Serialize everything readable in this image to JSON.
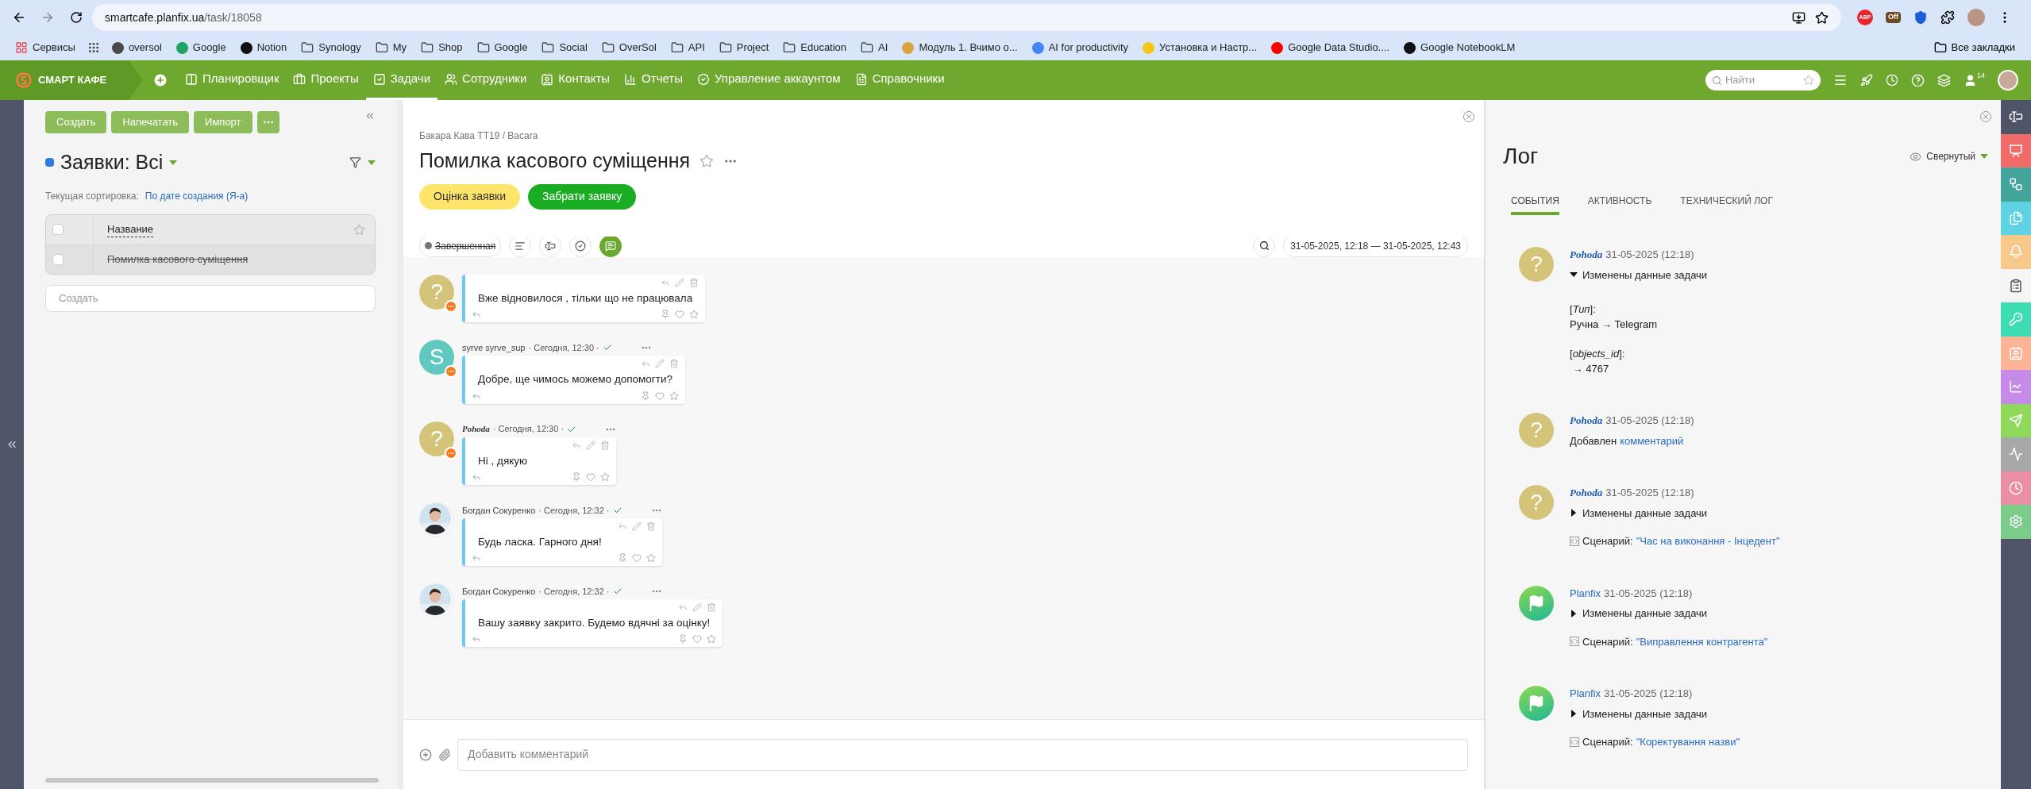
{
  "browser": {
    "url_host": "smartcafe.planfix.ua",
    "url_path": "/task/18058",
    "extensions": [
      {
        "label": "ABP",
        "kind": "adblock"
      },
      {
        "label": "Off",
        "kind": "badge"
      },
      {
        "kind": "shield"
      },
      {
        "kind": "puzzle"
      }
    ],
    "bookmarks": [
      {
        "label": "Сервисы",
        "kind": "apps"
      },
      {
        "kind": "grid"
      },
      {
        "label": "oversol",
        "kind": "site",
        "color": "#4a4a4a"
      },
      {
        "label": "Google",
        "kind": "site",
        "color": "#1fa463"
      },
      {
        "label": "Notion",
        "kind": "site",
        "color": "#111111"
      },
      {
        "label": "Synology",
        "kind": "folder"
      },
      {
        "label": "My",
        "kind": "folder"
      },
      {
        "label": "Shop",
        "kind": "folder"
      },
      {
        "label": "Google",
        "kind": "folder"
      },
      {
        "label": "Social",
        "kind": "folder"
      },
      {
        "label": "OverSol",
        "kind": "folder"
      },
      {
        "label": "API",
        "kind": "folder"
      },
      {
        "label": "Project",
        "kind": "folder"
      },
      {
        "label": "Education",
        "kind": "folder"
      },
      {
        "label": "AI",
        "kind": "folder"
      },
      {
        "label": "Модуль 1. Вчимо о...",
        "kind": "site",
        "color": "#d9a441"
      },
      {
        "label": "AI for productivity",
        "kind": "site",
        "color": "#4285f4"
      },
      {
        "label": "Установка и Настр...",
        "kind": "site",
        "color": "#f5c518"
      },
      {
        "label": "Google Data Studio....",
        "kind": "site",
        "color": "#ff0000"
      },
      {
        "label": "Google NotebookLM",
        "kind": "site",
        "color": "#111111"
      }
    ],
    "all_bookmarks": "Все закладки"
  },
  "nav": {
    "brand": "СМАРТ КАФЕ",
    "items": [
      {
        "label": "Планировщик",
        "selected": false
      },
      {
        "label": "Проекты",
        "selected": false
      },
      {
        "label": "Задачи",
        "selected": true
      },
      {
        "label": "Сотрудники",
        "selected": false
      },
      {
        "label": "Контакты",
        "selected": false
      },
      {
        "label": "Отчеты",
        "selected": false
      },
      {
        "label": "Управление аккаунтом",
        "selected": false
      },
      {
        "label": "Справочники",
        "selected": false
      }
    ],
    "search_placeholder": "Найти",
    "user_count": "14"
  },
  "list_panel": {
    "buttons": [
      "Создать",
      "Напечатать",
      "Импорт"
    ],
    "title": "Заявки: Всі",
    "sort_label": "Текущая сортировка:",
    "sort_value": "По дате создания (Я-а)",
    "column": "Название",
    "all_checked": false,
    "rows": [
      {
        "title": "Помилка касового суміщення",
        "done": true,
        "checked": false
      }
    ],
    "create_placeholder": "Создать"
  },
  "task": {
    "breadcrumb": "Бакара Кава ТТ19 / Bacara",
    "title": "Помилка касового суміщення",
    "actions": [
      {
        "label": "Оцінка заявки",
        "kind": "yellow"
      },
      {
        "label": "Забрати заявку",
        "kind": "green"
      }
    ],
    "status": "Завершенная",
    "tools": [
      {
        "kind": "description",
        "selected": false
      },
      {
        "kind": "fields",
        "selected": false
      },
      {
        "kind": "checklist",
        "selected": false
      },
      {
        "kind": "comments",
        "selected": true
      }
    ],
    "date_range": "31-05-2025, 12:18 — 31-05-2025, 12:43",
    "messages": [
      {
        "avatar": {
          "kind": "unknown",
          "letter": "?"
        },
        "badge": true,
        "text": "Вже відновилося , тільки що не працювала"
      },
      {
        "author": "syrve syrve_sup",
        "script_font": false,
        "time": "· Сегодня, 12:30 ·",
        "read": true,
        "avatar": {
          "kind": "letter",
          "letter": "S"
        },
        "badge": true,
        "text": "Добре, ще чимось можемо допомогти?"
      },
      {
        "author": "Pohoda",
        "script_font": true,
        "time": "· Сегодня, 12:30 ·",
        "read": true,
        "avatar": {
          "kind": "unknown",
          "letter": "?"
        },
        "badge": true,
        "text": "Ні , дякую"
      },
      {
        "author": "Богдан Сокуренко",
        "script_font": false,
        "time": "· Сегодня, 12:32 ·",
        "read": true,
        "badge": false,
        "text": "Будь ласка. Гарного дня!"
      },
      {
        "author": "Богдан Сокуренко",
        "script_font": false,
        "time": "· Сегодня, 12:32 ·",
        "read": true,
        "badge": false,
        "text": "Вашу заявку закрито. Будемо вдячні за оцінку!"
      }
    ],
    "comment_placeholder": "Добавить комментарий"
  },
  "log": {
    "title": "Лог",
    "view": "Свернутый",
    "tabs": [
      {
        "label": "СОБЫТИЯ",
        "selected": true
      },
      {
        "label": "АКТИВНОСТЬ",
        "selected": false
      },
      {
        "label": "ТЕХНИЧЕСКИЙ ЛОГ",
        "selected": false
      }
    ],
    "entries": [
      {
        "author": "Pohoda",
        "script_font": true,
        "avatar": {
          "kind": "unknown",
          "letter": "?"
        },
        "time": "31-05-2025 (12:18)",
        "kind": "changed",
        "action": "Изменены данные задачи",
        "expanded": true,
        "details": [
          {
            "field": "[*Тип*]:",
            "change": "Ручна → Telegram"
          },
          {
            "field": "[*objects_id*]:",
            "change": " → 4767"
          }
        ]
      },
      {
        "author": "Pohoda",
        "script_font": true,
        "avatar": {
          "kind": "unknown",
          "letter": "?"
        },
        "time": "31-05-2025 (12:18)",
        "kind": "comment",
        "action": "Добавлен",
        "link": "комментарий"
      },
      {
        "author": "Pohoda",
        "script_font": true,
        "avatar": {
          "kind": "unknown",
          "letter": "?"
        },
        "time": "31-05-2025 (12:18)",
        "kind": "changed",
        "action": "Изменены данные задачи",
        "expanded": false,
        "scenario_label": "Сценарий:",
        "scenario": "\"Час на виконання - Інцедент\""
      },
      {
        "author": "Planfix",
        "script_font": false,
        "avatar": {
          "kind": "bot"
        },
        "time": "31-05-2025 (12:18)",
        "kind": "changed",
        "action": "Изменены данные задачи",
        "expanded": false,
        "scenario_label": "Сценарий:",
        "scenario": "\"Виправлення контрагента\""
      },
      {
        "author": "Planfix",
        "script_font": false,
        "avatar": {
          "kind": "bot"
        },
        "time": "31-05-2025 (12:18)",
        "kind": "changed",
        "action": "Изменены данные задачи",
        "expanded": false,
        "scenario_label": "Сценарий:",
        "scenario": "\"Коректування назви\""
      }
    ]
  },
  "side_tools": [
    {
      "color": "#4f5468",
      "selected": false
    },
    {
      "color": "#f26b6b",
      "selected": false
    },
    {
      "color": "#45a59c",
      "selected": false
    },
    {
      "color": "#5fd2e4",
      "selected": false
    },
    {
      "color": "#f7c98b",
      "selected": false
    },
    {
      "color": "#f5f5f5",
      "selected": true
    },
    {
      "color": "#3ddcb2",
      "selected": false
    },
    {
      "color": "#fbb596",
      "selected": false
    },
    {
      "color": "#c68ae9",
      "selected": false
    },
    {
      "color": "#8fd95b",
      "selected": false
    },
    {
      "color": "#a8a8a8",
      "selected": false
    },
    {
      "color": "#ea8fa1",
      "selected": false
    },
    {
      "color": "#7bcb8b",
      "selected": false
    }
  ]
}
